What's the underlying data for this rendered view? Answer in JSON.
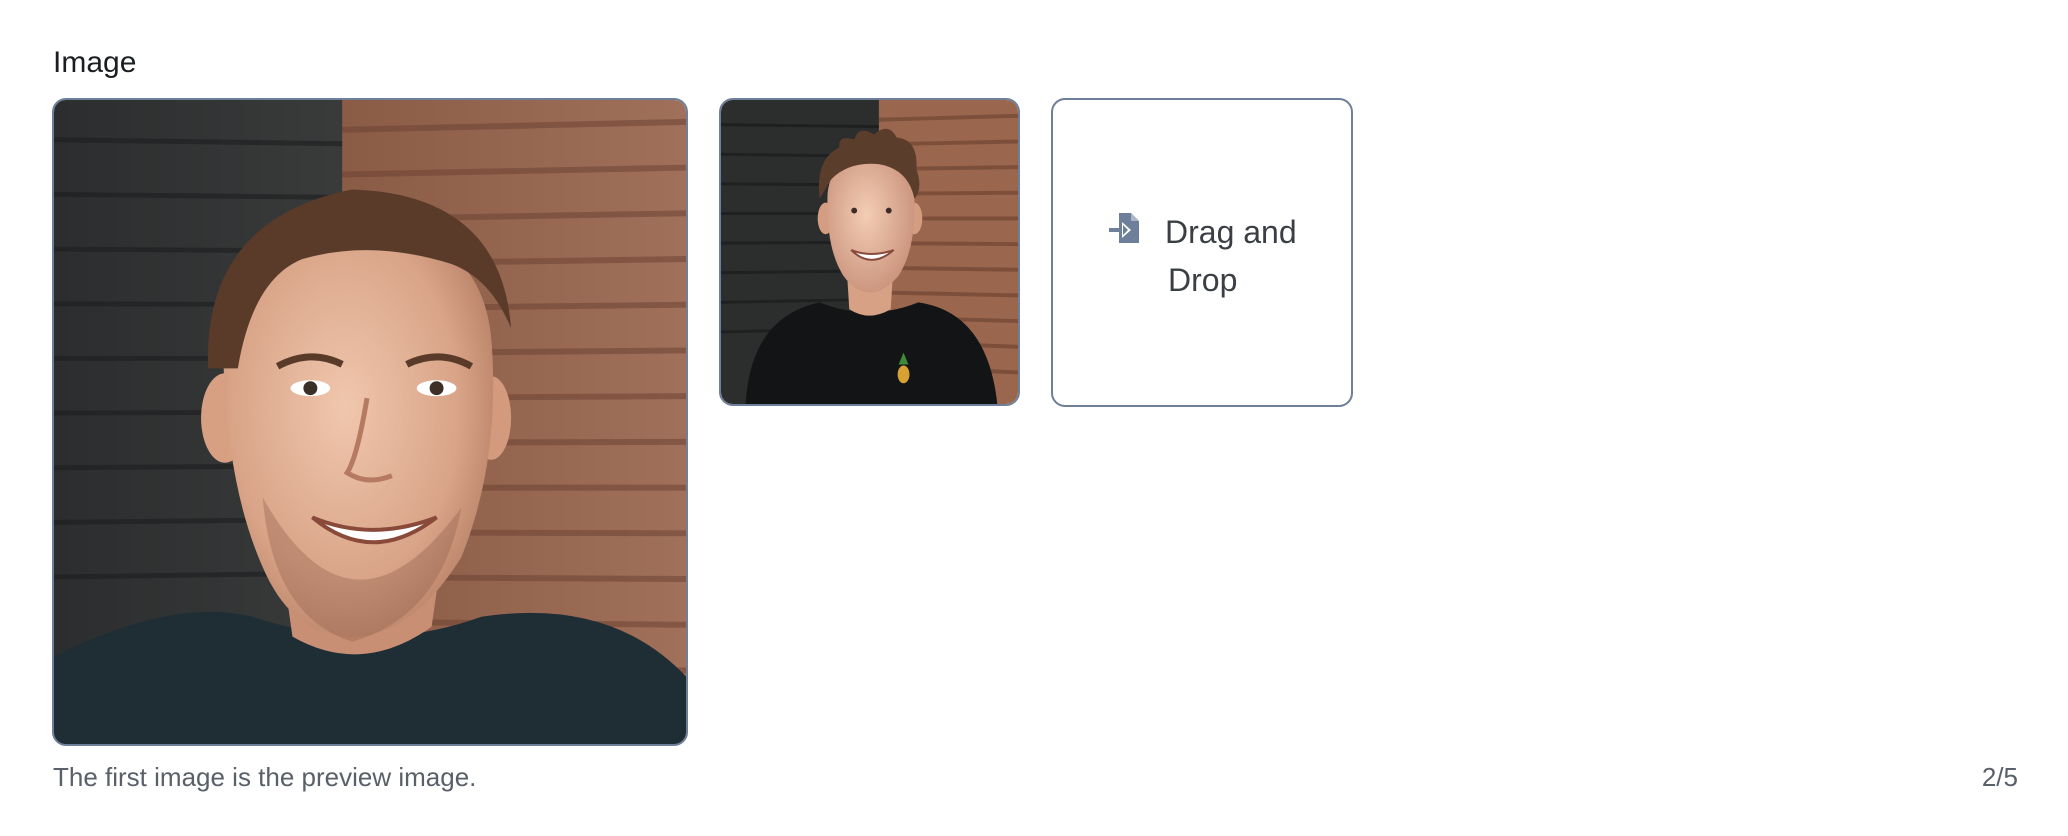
{
  "field": {
    "label": "Image",
    "help_text": "The first image is the preview image.",
    "counter": "2/5"
  },
  "images": [
    {
      "name": "preview-image"
    },
    {
      "name": "second-image"
    }
  ],
  "dropzone": {
    "icon": "file-import-icon",
    "label_line1": "Drag and",
    "label_line2": "Drop"
  },
  "colors": {
    "border": "#6d7f99",
    "icon": "#6d7f99",
    "text": "#1a1d21",
    "muted_text": "#5a6069"
  }
}
